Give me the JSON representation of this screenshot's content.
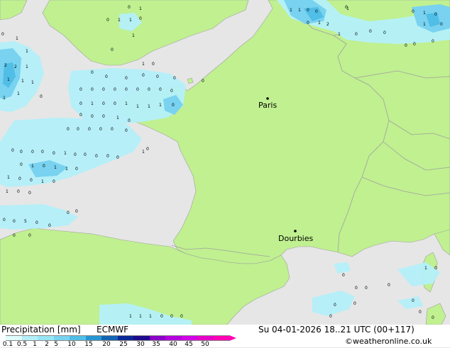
{
  "map": {
    "cities": [
      {
        "name": "Paris"
      },
      {
        "name": "Dourbies"
      }
    ]
  },
  "footer": {
    "title": "Precipitation [mm]",
    "model": "ECMWF",
    "datetime": "Su 04-01-2026 18..21 UTC (00+117)",
    "credit": "©weatheronline.co.uk",
    "scale_ticks": [
      "0.1",
      "0.5",
      "1",
      "2",
      "5",
      "10",
      "15",
      "20",
      "25",
      "30",
      "35",
      "40",
      "45",
      "50"
    ],
    "scale_colors": [
      "#e0ffff",
      "#b4f0fa",
      "#96e6f5",
      "#78d2f0",
      "#50bee6",
      "#2896d2",
      "#1464b4",
      "#0a2896",
      "#1e0a8c",
      "#8c00c8",
      "#b400dc",
      "#d200e6",
      "#e600c8",
      "#ff00b4"
    ]
  }
}
